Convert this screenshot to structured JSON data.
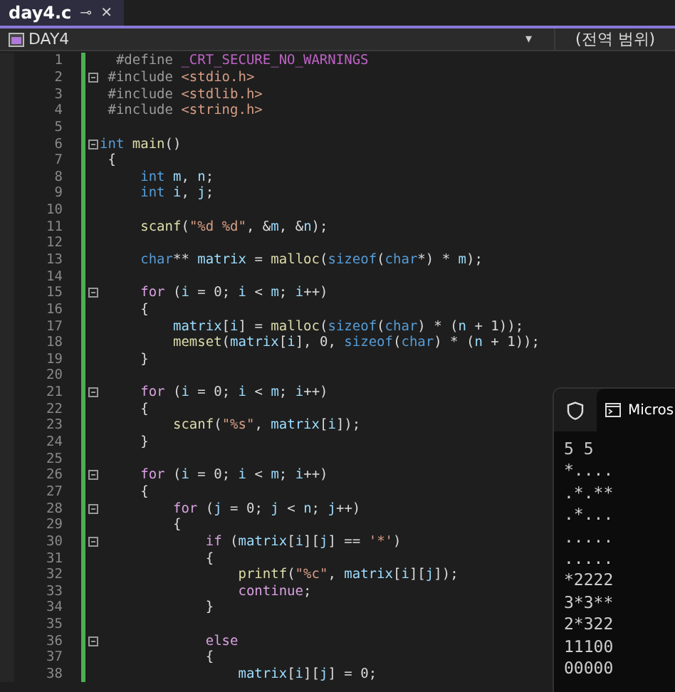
{
  "tab": {
    "title": "day4.c",
    "pin": "⊸",
    "close": "✕",
    "selected": true
  },
  "nav": {
    "project": "DAY4",
    "caret": "▾",
    "scope": "(전역 범위)"
  },
  "lines": [
    {
      "n": "1",
      "fold": false,
      "tokens": [
        {
          "text": "  #define",
          "kind": "pre"
        },
        {
          "text": " _CRT_SECURE_NO_WARNINGS",
          "kind": "macro"
        }
      ]
    },
    {
      "n": "2",
      "fold": true,
      "tokens": [
        {
          "text": " #include",
          "kind": "pre"
        },
        {
          "text": " <stdio.h>",
          "kind": "str"
        }
      ]
    },
    {
      "n": "3",
      "fold": false,
      "tokens": [
        {
          "text": " #include",
          "kind": "pre"
        },
        {
          "text": " <stdlib.h>",
          "kind": "str"
        }
      ]
    },
    {
      "n": "4",
      "fold": false,
      "tokens": [
        {
          "text": " #include",
          "kind": "pre"
        },
        {
          "text": " <string.h>",
          "kind": "str"
        }
      ]
    },
    {
      "n": "5",
      "fold": false
    },
    {
      "n": "6",
      "fold": true,
      "tokens": [
        {
          "text": "int",
          "kind": "kw"
        },
        {
          "text": " main",
          "kind": "fn"
        },
        {
          "text": "()",
          "kind": "plain"
        }
      ]
    },
    {
      "n": "7",
      "fold": false,
      "tokens": [
        {
          "text": " {",
          "kind": "plain"
        }
      ]
    },
    {
      "n": "8",
      "fold": false,
      "tokens": [
        {
          "text": "     int",
          "kind": "kw"
        },
        {
          "text": " m",
          "kind": "var"
        },
        {
          "text": ", ",
          "kind": "plain"
        },
        {
          "text": "n",
          "kind": "var"
        },
        {
          "text": ";",
          "kind": "plain"
        }
      ]
    },
    {
      "n": "9",
      "fold": false,
      "tokens": [
        {
          "text": "     int",
          "kind": "kw"
        },
        {
          "text": " i",
          "kind": "var"
        },
        {
          "text": ", ",
          "kind": "plain"
        },
        {
          "text": "j",
          "kind": "var"
        },
        {
          "text": ";",
          "kind": "plain"
        }
      ]
    },
    {
      "n": "10",
      "fold": false
    },
    {
      "n": "11",
      "fold": false,
      "tokens": [
        {
          "text": "     scanf",
          "kind": "fn"
        },
        {
          "text": "(",
          "kind": "plain"
        },
        {
          "text": "\"%d %d\"",
          "kind": "str"
        },
        {
          "text": ", &",
          "kind": "plain"
        },
        {
          "text": "m",
          "kind": "var"
        },
        {
          "text": ", &",
          "kind": "plain"
        },
        {
          "text": "n",
          "kind": "var"
        },
        {
          "text": ");",
          "kind": "plain"
        }
      ]
    },
    {
      "n": "12",
      "fold": false
    },
    {
      "n": "13",
      "fold": false,
      "tokens": [
        {
          "text": "     char",
          "kind": "kw"
        },
        {
          "text": "** ",
          "kind": "plain"
        },
        {
          "text": "matrix",
          "kind": "var"
        },
        {
          "text": " = ",
          "kind": "plain"
        },
        {
          "text": "malloc",
          "kind": "fn"
        },
        {
          "text": "(",
          "kind": "plain"
        },
        {
          "text": "sizeof",
          "kind": "kw"
        },
        {
          "text": "(",
          "kind": "plain"
        },
        {
          "text": "char",
          "kind": "kw"
        },
        {
          "text": "*) * ",
          "kind": "plain"
        },
        {
          "text": "m",
          "kind": "var"
        },
        {
          "text": ");",
          "kind": "plain"
        }
      ]
    },
    {
      "n": "14",
      "fold": false
    },
    {
      "n": "15",
      "fold": true,
      "tokens": [
        {
          "text": "     for",
          "kind": "ctrl"
        },
        {
          "text": " (",
          "kind": "plain"
        },
        {
          "text": "i",
          "kind": "var"
        },
        {
          "text": " = 0; ",
          "kind": "plain"
        },
        {
          "text": "i",
          "kind": "var"
        },
        {
          "text": " < ",
          "kind": "plain"
        },
        {
          "text": "m",
          "kind": "var"
        },
        {
          "text": "; ",
          "kind": "plain"
        },
        {
          "text": "i",
          "kind": "var"
        },
        {
          "text": "++)",
          "kind": "plain"
        }
      ]
    },
    {
      "n": "16",
      "fold": false,
      "tokens": [
        {
          "text": "     {",
          "kind": "plain"
        }
      ]
    },
    {
      "n": "17",
      "fold": false,
      "tokens": [
        {
          "text": "         matrix",
          "kind": "var"
        },
        {
          "text": "[",
          "kind": "plain"
        },
        {
          "text": "i",
          "kind": "var"
        },
        {
          "text": "] = ",
          "kind": "plain"
        },
        {
          "text": "malloc",
          "kind": "fn"
        },
        {
          "text": "(",
          "kind": "plain"
        },
        {
          "text": "sizeof",
          "kind": "kw"
        },
        {
          "text": "(",
          "kind": "plain"
        },
        {
          "text": "char",
          "kind": "kw"
        },
        {
          "text": ") * (",
          "kind": "plain"
        },
        {
          "text": "n",
          "kind": "var"
        },
        {
          "text": " + 1));",
          "kind": "plain"
        }
      ]
    },
    {
      "n": "18",
      "fold": false,
      "tokens": [
        {
          "text": "         memset",
          "kind": "fn"
        },
        {
          "text": "(",
          "kind": "plain"
        },
        {
          "text": "matrix",
          "kind": "var"
        },
        {
          "text": "[",
          "kind": "plain"
        },
        {
          "text": "i",
          "kind": "var"
        },
        {
          "text": "], 0, ",
          "kind": "plain"
        },
        {
          "text": "sizeof",
          "kind": "kw"
        },
        {
          "text": "(",
          "kind": "plain"
        },
        {
          "text": "char",
          "kind": "kw"
        },
        {
          "text": ") * (",
          "kind": "plain"
        },
        {
          "text": "n",
          "kind": "var"
        },
        {
          "text": " + 1));",
          "kind": "plain"
        }
      ]
    },
    {
      "n": "19",
      "fold": false,
      "tokens": [
        {
          "text": "     }",
          "kind": "plain"
        }
      ]
    },
    {
      "n": "20",
      "fold": false
    },
    {
      "n": "21",
      "fold": true,
      "tokens": [
        {
          "text": "     for",
          "kind": "ctrl"
        },
        {
          "text": " (",
          "kind": "plain"
        },
        {
          "text": "i",
          "kind": "var"
        },
        {
          "text": " = 0; ",
          "kind": "plain"
        },
        {
          "text": "i",
          "kind": "var"
        },
        {
          "text": " < ",
          "kind": "plain"
        },
        {
          "text": "m",
          "kind": "var"
        },
        {
          "text": "; ",
          "kind": "plain"
        },
        {
          "text": "i",
          "kind": "var"
        },
        {
          "text": "++)",
          "kind": "plain"
        }
      ]
    },
    {
      "n": "22",
      "fold": false,
      "tokens": [
        {
          "text": "     {",
          "kind": "plain"
        }
      ]
    },
    {
      "n": "23",
      "fold": false,
      "tokens": [
        {
          "text": "         scanf",
          "kind": "fn"
        },
        {
          "text": "(",
          "kind": "plain"
        },
        {
          "text": "\"%s\"",
          "kind": "str"
        },
        {
          "text": ", ",
          "kind": "plain"
        },
        {
          "text": "matrix",
          "kind": "var"
        },
        {
          "text": "[",
          "kind": "plain"
        },
        {
          "text": "i",
          "kind": "var"
        },
        {
          "text": "]);",
          "kind": "plain"
        }
      ]
    },
    {
      "n": "24",
      "fold": false,
      "tokens": [
        {
          "text": "     }",
          "kind": "plain"
        }
      ]
    },
    {
      "n": "25",
      "fold": false
    },
    {
      "n": "26",
      "fold": true,
      "tokens": [
        {
          "text": "     for",
          "kind": "ctrl"
        },
        {
          "text": " (",
          "kind": "plain"
        },
        {
          "text": "i",
          "kind": "var"
        },
        {
          "text": " = 0; ",
          "kind": "plain"
        },
        {
          "text": "i",
          "kind": "var"
        },
        {
          "text": " < ",
          "kind": "plain"
        },
        {
          "text": "m",
          "kind": "var"
        },
        {
          "text": "; ",
          "kind": "plain"
        },
        {
          "text": "i",
          "kind": "var"
        },
        {
          "text": "++)",
          "kind": "plain"
        }
      ]
    },
    {
      "n": "27",
      "fold": false,
      "tokens": [
        {
          "text": "     {",
          "kind": "plain"
        }
      ]
    },
    {
      "n": "28",
      "fold": true,
      "tokens": [
        {
          "text": "         for",
          "kind": "ctrl"
        },
        {
          "text": " (",
          "kind": "plain"
        },
        {
          "text": "j",
          "kind": "var"
        },
        {
          "text": " = 0; ",
          "kind": "plain"
        },
        {
          "text": "j",
          "kind": "var"
        },
        {
          "text": " < ",
          "kind": "plain"
        },
        {
          "text": "n",
          "kind": "var"
        },
        {
          "text": "; ",
          "kind": "plain"
        },
        {
          "text": "j",
          "kind": "var"
        },
        {
          "text": "++)",
          "kind": "plain"
        }
      ]
    },
    {
      "n": "29",
      "fold": false,
      "tokens": [
        {
          "text": "         {",
          "kind": "plain"
        }
      ]
    },
    {
      "n": "30",
      "fold": true,
      "tokens": [
        {
          "text": "             if",
          "kind": "ctrl"
        },
        {
          "text": " (",
          "kind": "plain"
        },
        {
          "text": "matrix",
          "kind": "var"
        },
        {
          "text": "[",
          "kind": "plain"
        },
        {
          "text": "i",
          "kind": "var"
        },
        {
          "text": "][",
          "kind": "plain"
        },
        {
          "text": "j",
          "kind": "var"
        },
        {
          "text": "] == ",
          "kind": "plain"
        },
        {
          "text": "'*'",
          "kind": "str"
        },
        {
          "text": ")",
          "kind": "plain"
        }
      ]
    },
    {
      "n": "31",
      "fold": false,
      "tokens": [
        {
          "text": "             {",
          "kind": "plain"
        }
      ]
    },
    {
      "n": "32",
      "fold": false,
      "tokens": [
        {
          "text": "                 printf",
          "kind": "fn"
        },
        {
          "text": "(",
          "kind": "plain"
        },
        {
          "text": "\"%c\"",
          "kind": "str"
        },
        {
          "text": ", ",
          "kind": "plain"
        },
        {
          "text": "matrix",
          "kind": "var"
        },
        {
          "text": "[",
          "kind": "plain"
        },
        {
          "text": "i",
          "kind": "var"
        },
        {
          "text": "][",
          "kind": "plain"
        },
        {
          "text": "j",
          "kind": "var"
        },
        {
          "text": "]);",
          "kind": "plain"
        }
      ]
    },
    {
      "n": "33",
      "fold": false,
      "tokens": [
        {
          "text": "                 continue",
          "kind": "ctrl"
        },
        {
          "text": ";",
          "kind": "plain"
        }
      ]
    },
    {
      "n": "34",
      "fold": false,
      "tokens": [
        {
          "text": "             }",
          "kind": "plain"
        }
      ]
    },
    {
      "n": "35",
      "fold": false
    },
    {
      "n": "36",
      "fold": true,
      "tokens": [
        {
          "text": "             else",
          "kind": "ctrl"
        }
      ]
    },
    {
      "n": "37",
      "fold": false,
      "tokens": [
        {
          "text": "             {",
          "kind": "plain"
        }
      ]
    },
    {
      "n": "38",
      "fold": false,
      "tokens": [
        {
          "text": "                 matrix",
          "kind": "var"
        },
        {
          "text": "[",
          "kind": "plain"
        },
        {
          "text": "i",
          "kind": "var"
        },
        {
          "text": "][",
          "kind": "plain"
        },
        {
          "text": "j",
          "kind": "var"
        },
        {
          "text": "] = 0;",
          "kind": "plain"
        }
      ]
    }
  ],
  "console": {
    "title": "Micros",
    "output": [
      "5 5",
      "*....",
      ".*.**",
      ".*...",
      ".....",
      ".....",
      "*2222",
      "3*3**",
      "2*322",
      "11100",
      "00000"
    ]
  }
}
